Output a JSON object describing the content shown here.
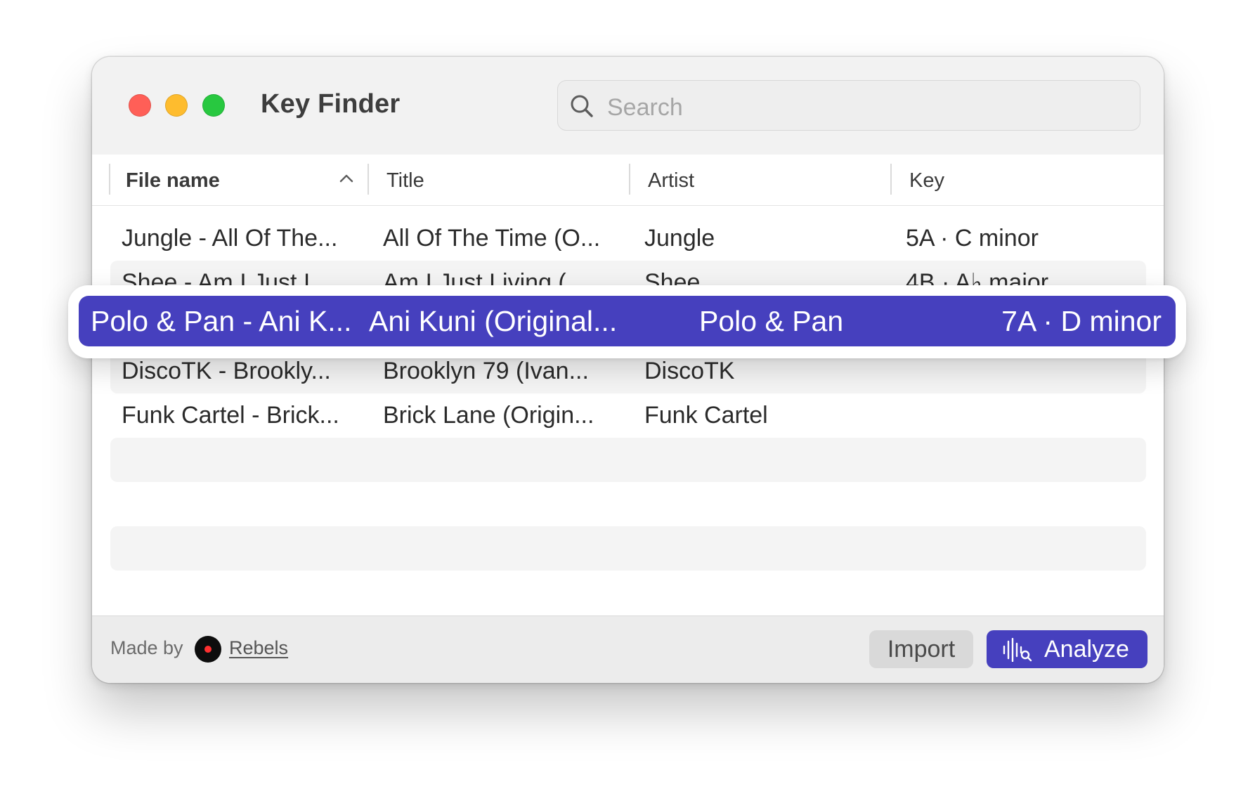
{
  "window": {
    "title": "Key Finder"
  },
  "search": {
    "placeholder": "Search"
  },
  "columns": {
    "file_name": "File name",
    "title": "Title",
    "artist": "Artist",
    "key": "Key"
  },
  "rows": [
    {
      "file": "Jungle - All Of The...",
      "title": "All Of The Time (O...",
      "artist": "Jungle",
      "key": "5A · C minor"
    },
    {
      "file": "Shee - Am I Just I",
      "title": "Am I Just Living (",
      "artist": "Shee",
      "key": "4B · A♭ major"
    },
    {
      "file": "DiscoTK - Brookly...",
      "title": "Brooklyn 79 (Ivan...",
      "artist": "DiscoTK",
      "key": ""
    },
    {
      "file": "Funk Cartel - Brick...",
      "title": "Brick Lane (Origin...",
      "artist": "Funk Cartel",
      "key": ""
    }
  ],
  "selected_row": {
    "file": "Polo & Pan - Ani K...",
    "title": "Ani Kuni (Original...",
    "artist": "Polo & Pan",
    "key": "7A · D minor"
  },
  "footer": {
    "made_by": "Made by",
    "brand_link": "Rebels",
    "import_label": "Import",
    "analyze_label": "Analyze"
  },
  "icons": {
    "search": "magnifier-icon",
    "sort": "chevron-up-icon",
    "analyze": "waveform-search-icon",
    "brand": "rebels-logo"
  },
  "colors": {
    "accent": "#4640be",
    "traffic_red": "#ff5f57",
    "traffic_yellow": "#febc2e",
    "traffic_green": "#28c840"
  }
}
